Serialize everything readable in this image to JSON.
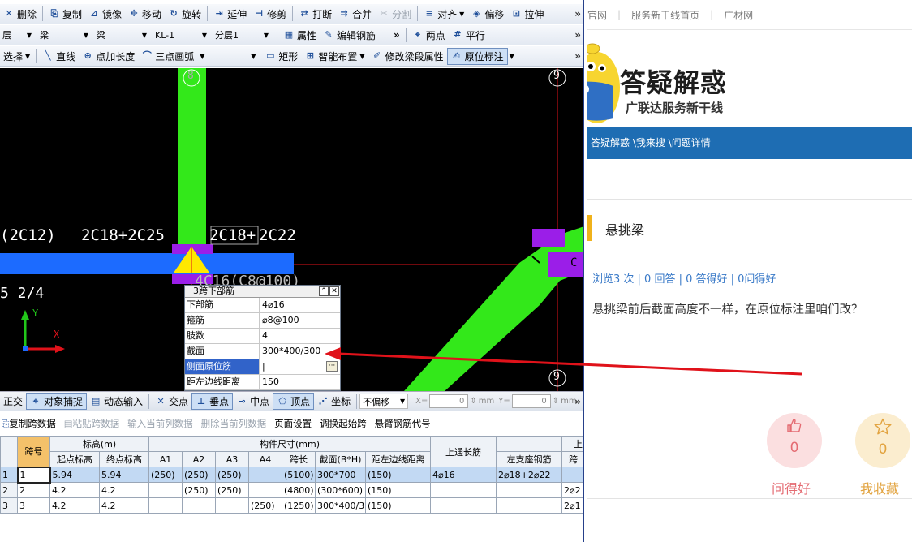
{
  "cad": {
    "toolbar1": {
      "items": [
        {
          "icon": "✕",
          "label": "删除"
        },
        {
          "icon": "⎘",
          "label": "复制"
        },
        {
          "icon": "⊿",
          "label": "镜像"
        },
        {
          "icon": "✥",
          "label": "移动"
        },
        {
          "icon": "↻",
          "label": "旋转"
        },
        {
          "icon": "⇥",
          "label": "延伸"
        },
        {
          "icon": "⊣",
          "label": "修剪"
        },
        {
          "icon": "⇄",
          "label": "打断"
        },
        {
          "icon": "⇉",
          "label": "合并"
        },
        {
          "icon": "✂",
          "label": "分割"
        },
        {
          "icon": "≡",
          "label": "对齐"
        },
        {
          "icon": "◈",
          "label": "偏移"
        },
        {
          "icon": "⊡",
          "label": "拉伸"
        }
      ],
      "more": "»"
    },
    "toolbar2": {
      "combos": [
        "层",
        "梁",
        "梁",
        "KL-1",
        "分层1"
      ],
      "items": [
        {
          "icon": "▦",
          "label": "属性"
        },
        {
          "icon": "✎",
          "label": "编辑钢筋"
        }
      ],
      "items2": [
        {
          "icon": "⌖",
          "label": "两点"
        },
        {
          "icon": "#",
          "label": "平行"
        }
      ],
      "more": "»"
    },
    "toolbar3": {
      "select": "选择",
      "items": [
        {
          "icon": "╲",
          "label": "直线"
        },
        {
          "icon": "⊕",
          "label": "点加长度"
        },
        {
          "icon": "⌒",
          "label": "三点画弧"
        },
        {
          "icon": "▭",
          "label": "矩形"
        },
        {
          "icon": "⊞",
          "label": "智能布置"
        },
        {
          "icon": "✐",
          "label": "修改梁段属性"
        },
        {
          "icon": "✍",
          "label": "原位标注"
        }
      ],
      "more": "»"
    },
    "canvas": {
      "labels": {
        "left_rebar": "(2C12)",
        "mid_rebar": "2C18+2C25",
        "right_rebar_a": "2C18+",
        "right_rebar_b": "2C22",
        "bottom_rebar": "4C16(C8@100)",
        "span": "5 2/4",
        "axis_top_left": "8",
        "axis_top_right": "9",
        "axis_bottom_right": "9",
        "cut_c": "C"
      },
      "ucs": {
        "x": "X",
        "y": "Y"
      }
    },
    "popup": {
      "title": "3跨下部筋",
      "rows": [
        {
          "key": "下部筋",
          "value": "4⌀16"
        },
        {
          "key": "箍筋",
          "value": "⌀8@100"
        },
        {
          "key": "肢数",
          "value": "4"
        },
        {
          "key": "截面",
          "value": "300*400/300"
        },
        {
          "key": "侧面原位筋",
          "value": "|"
        },
        {
          "key": "距左边线距离",
          "value": "150"
        }
      ]
    },
    "status": {
      "items": [
        "正交",
        "对象捕捉",
        "动态输入",
        "交点",
        "垂点",
        "中点",
        "顶点",
        "坐标"
      ],
      "offset_mode": "不偏移",
      "x_label": "X=",
      "x_value": "0",
      "y_label": "Y=",
      "y_value": "0",
      "unit": "mm",
      "more": "»"
    },
    "gridbar": {
      "items": [
        "复制跨数据",
        "粘贴跨数据",
        "输入当前列数据",
        "删除当前列数据",
        "页面设置",
        "调换起始跨",
        "悬臂钢筋代号"
      ]
    },
    "table": {
      "group_headers": {
        "span_no": "跨号",
        "elevation": "标高(m)",
        "section_size": "构件尺寸(mm)",
        "top_through": "上通长筋",
        "top_partial": "上"
      },
      "columns": [
        "起点标高",
        "终点标高",
        "A1",
        "A2",
        "A3",
        "A4",
        "跨长",
        "截面(B*H)",
        "距左边线距离",
        "左支座钢筋",
        "跨"
      ],
      "rows": [
        {
          "idx": "1",
          "span": "1",
          "start": "5.94",
          "end": "5.94",
          "a1": "(250)",
          "a2": "(250)",
          "a3": "(250)",
          "a4": "",
          "len": "(5100)",
          "sec": "300*700",
          "dist": "(150)",
          "top": "4⌀16",
          "left": "2⌀18+2⌀22",
          "span2": ""
        },
        {
          "idx": "2",
          "span": "2",
          "start": "4.2",
          "end": "4.2",
          "a1": "",
          "a2": "(250)",
          "a3": "(250)",
          "a4": "",
          "len": "(4800)",
          "sec": "(300*600)",
          "dist": "(150)",
          "top": "",
          "left": "",
          "span2": "2⌀2"
        },
        {
          "idx": "3",
          "span": "3",
          "start": "4.2",
          "end": "4.2",
          "a1": "",
          "a2": "",
          "a3": "",
          "a4": "(250)",
          "len": "(1250)",
          "sec": "300*400/3",
          "dist": "(150)",
          "top": "",
          "left": "",
          "span2": "2⌀1"
        }
      ]
    }
  },
  "web": {
    "topnav": [
      "官网",
      "服务新干线首页",
      "广材网"
    ],
    "brand_title": "答疑解惑",
    "brand_sub": "广联达服务新干线",
    "breadcrumb": "答疑解惑 \\我来搜 \\问题详情",
    "question_title": "悬挑梁",
    "stats": "浏览3 次 | 0 回答 | 0 答得好 | 0问得好",
    "question_body": "悬挑梁前后截面高度不一样，在原位标注里咱们改？",
    "like": {
      "icon": "thumbs-up-icon",
      "count": "0",
      "label": "问得好"
    },
    "favorite": {
      "icon": "star-icon",
      "count": "0",
      "label": "我收藏"
    }
  },
  "colors": {
    "brand_blue": "#1e6db3",
    "beam_green": "#33e81a",
    "beam_blue": "#1c6bff",
    "support_purple": "#9b1ee8",
    "annotation_red": "#e0121a",
    "accent_orange": "#f0b21b"
  }
}
